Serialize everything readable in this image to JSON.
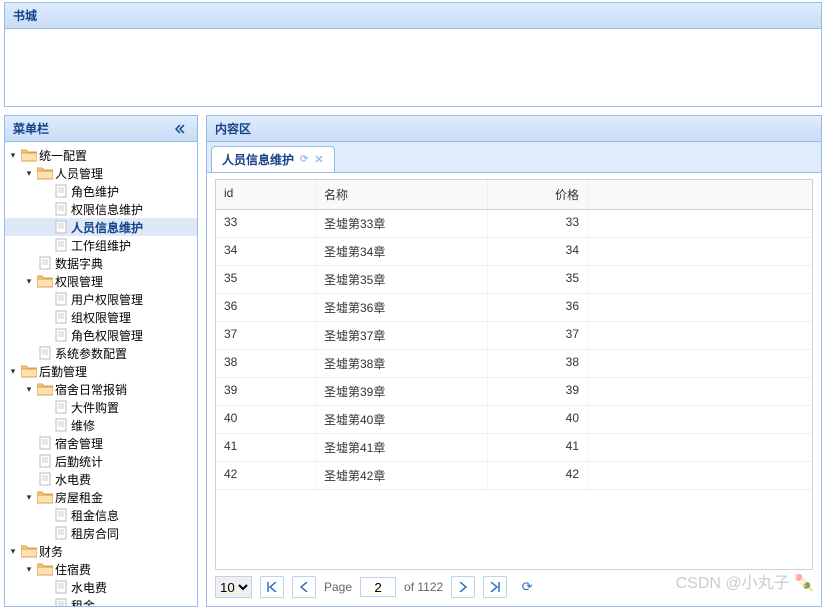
{
  "header": {
    "title": "书城"
  },
  "sidebar": {
    "title": "菜单栏",
    "nodes": [
      {
        "d": 0,
        "t": "fo",
        "l": "统一配置"
      },
      {
        "d": 1,
        "t": "fo",
        "l": "人员管理"
      },
      {
        "d": 2,
        "t": "f",
        "l": "角色维护"
      },
      {
        "d": 2,
        "t": "f",
        "l": "权限信息维护"
      },
      {
        "d": 2,
        "t": "f",
        "l": "人员信息维护",
        "sel": true
      },
      {
        "d": 2,
        "t": "f",
        "l": "工作组维护"
      },
      {
        "d": 1,
        "t": "f",
        "l": "数据字典"
      },
      {
        "d": 1,
        "t": "fo",
        "l": "权限管理"
      },
      {
        "d": 2,
        "t": "f",
        "l": "用户权限管理"
      },
      {
        "d": 2,
        "t": "f",
        "l": "组权限管理"
      },
      {
        "d": 2,
        "t": "f",
        "l": "角色权限管理"
      },
      {
        "d": 1,
        "t": "f",
        "l": "系统参数配置"
      },
      {
        "d": 0,
        "t": "fo",
        "l": "后勤管理"
      },
      {
        "d": 1,
        "t": "fo",
        "l": "宿舍日常报销"
      },
      {
        "d": 2,
        "t": "f",
        "l": "大件购置"
      },
      {
        "d": 2,
        "t": "f",
        "l": "维修"
      },
      {
        "d": 1,
        "t": "f",
        "l": "宿舍管理"
      },
      {
        "d": 1,
        "t": "f",
        "l": "后勤统计"
      },
      {
        "d": 1,
        "t": "f",
        "l": "水电费"
      },
      {
        "d": 1,
        "t": "fo",
        "l": "房屋租金"
      },
      {
        "d": 2,
        "t": "f",
        "l": "租金信息"
      },
      {
        "d": 2,
        "t": "f",
        "l": "租房合同"
      },
      {
        "d": 0,
        "t": "fo",
        "l": "财务"
      },
      {
        "d": 1,
        "t": "fo",
        "l": "住宿费"
      },
      {
        "d": 2,
        "t": "f",
        "l": "水电费"
      },
      {
        "d": 2,
        "t": "f",
        "l": "租金"
      }
    ]
  },
  "content": {
    "title": "内容区",
    "tab": {
      "label": "人员信息维护"
    },
    "grid": {
      "cols": [
        "id",
        "名称",
        "价格"
      ],
      "rows": [
        {
          "id": "33",
          "name": "圣墟第33章",
          "price": "33"
        },
        {
          "id": "34",
          "name": "圣墟第34章",
          "price": "34"
        },
        {
          "id": "35",
          "name": "圣墟第35章",
          "price": "35"
        },
        {
          "id": "36",
          "name": "圣墟第36章",
          "price": "36"
        },
        {
          "id": "37",
          "name": "圣墟第37章",
          "price": "37"
        },
        {
          "id": "38",
          "name": "圣墟第38章",
          "price": "38"
        },
        {
          "id": "39",
          "name": "圣墟第39章",
          "price": "39"
        },
        {
          "id": "40",
          "name": "圣墟第40章",
          "price": "40"
        },
        {
          "id": "41",
          "name": "圣墟第41章",
          "price": "41"
        },
        {
          "id": "42",
          "name": "圣墟第42章",
          "price": "42"
        }
      ]
    },
    "pager": {
      "size": "10",
      "page_label": "Page",
      "page": "2",
      "total": "of 1122"
    }
  },
  "watermark": "CSDN @小丸子 🍡"
}
